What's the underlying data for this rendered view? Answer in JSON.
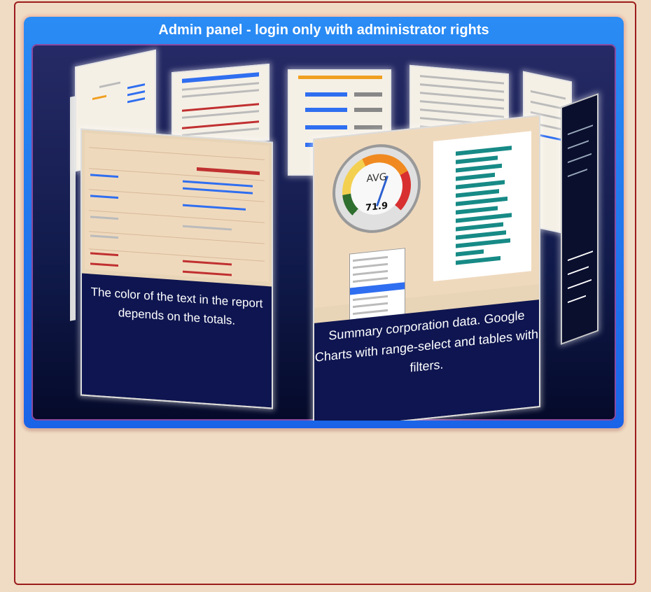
{
  "panel": {
    "title": "Admin panel - login only with administrator rights"
  },
  "carousel": {
    "front_left": {
      "caption": "The color of the text in the report depends on the totals."
    },
    "front_right": {
      "caption": "Summary corporation data. Google Charts with range-select and tables with filters.",
      "gauge_label": "AVG",
      "gauge_value": "71.9"
    }
  },
  "colors": {
    "background": "#f0dcc4",
    "frame_border": "#9b1c1c",
    "panel_blue": "#2a8cf4",
    "stage_dark": "#101a4a",
    "bar_teal": "#178a86"
  }
}
